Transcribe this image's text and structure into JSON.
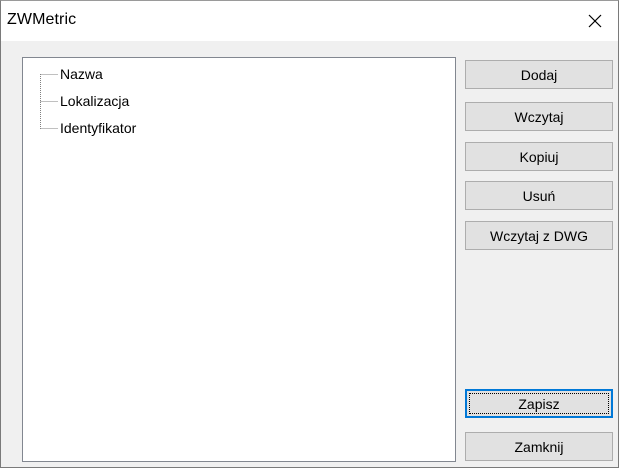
{
  "window": {
    "title": "ZWMetric",
    "close_glyph": "close-icon"
  },
  "tree": {
    "items": [
      {
        "label": "Nazwa"
      },
      {
        "label": "Lokalizacja"
      },
      {
        "label": "Identyfikator"
      }
    ]
  },
  "buttons": {
    "add": "Dodaj",
    "load": "Wczytaj",
    "copy": "Kopiuj",
    "delete": "Usuń",
    "load_dwg": "Wczytaj z DWG",
    "save": "Zapisz",
    "close": "Zamknij"
  },
  "colors": {
    "focus_border": "#0078d7",
    "button_face": "#e1e1e1",
    "window_bg": "#f0f0f0"
  }
}
